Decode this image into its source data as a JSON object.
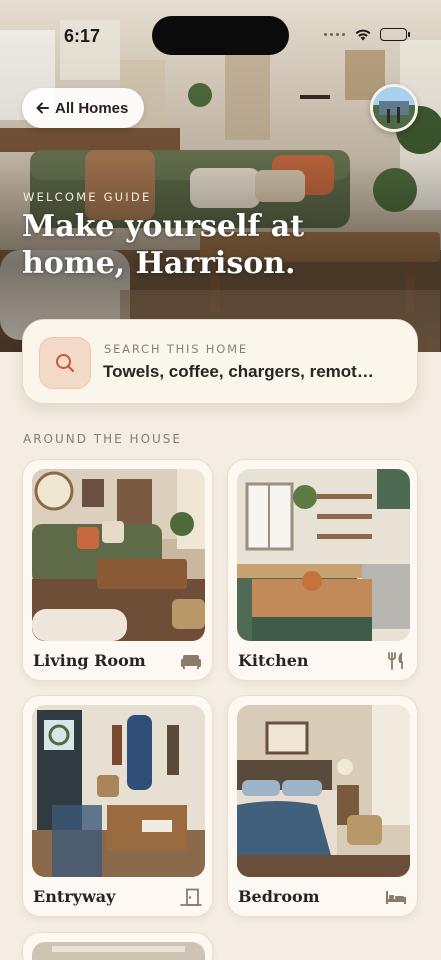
{
  "status_bar": {
    "time": "6:17"
  },
  "header": {
    "back_label": "All Homes",
    "eyebrow": "WELCOME GUIDE",
    "title": "Make yourself at home, Harrison."
  },
  "search": {
    "label": "SEARCH THIS HOME",
    "value": "Towels, coffee, chargers, remot…"
  },
  "section": {
    "title": "AROUND THE HOUSE"
  },
  "rooms": [
    {
      "name": "Living Room",
      "icon": "sofa-icon"
    },
    {
      "name": "Kitchen",
      "icon": "fork-knife-icon"
    },
    {
      "name": "Entryway",
      "icon": "door-icon"
    },
    {
      "name": "Bedroom",
      "icon": "bed-icon"
    }
  ],
  "colors": {
    "background": "#f3ede3",
    "card": "#fdf9f2",
    "accent": "#c8553d",
    "accent_soft": "#f3d9c8",
    "text": "#2b2320",
    "muted": "#8b7b6c"
  }
}
